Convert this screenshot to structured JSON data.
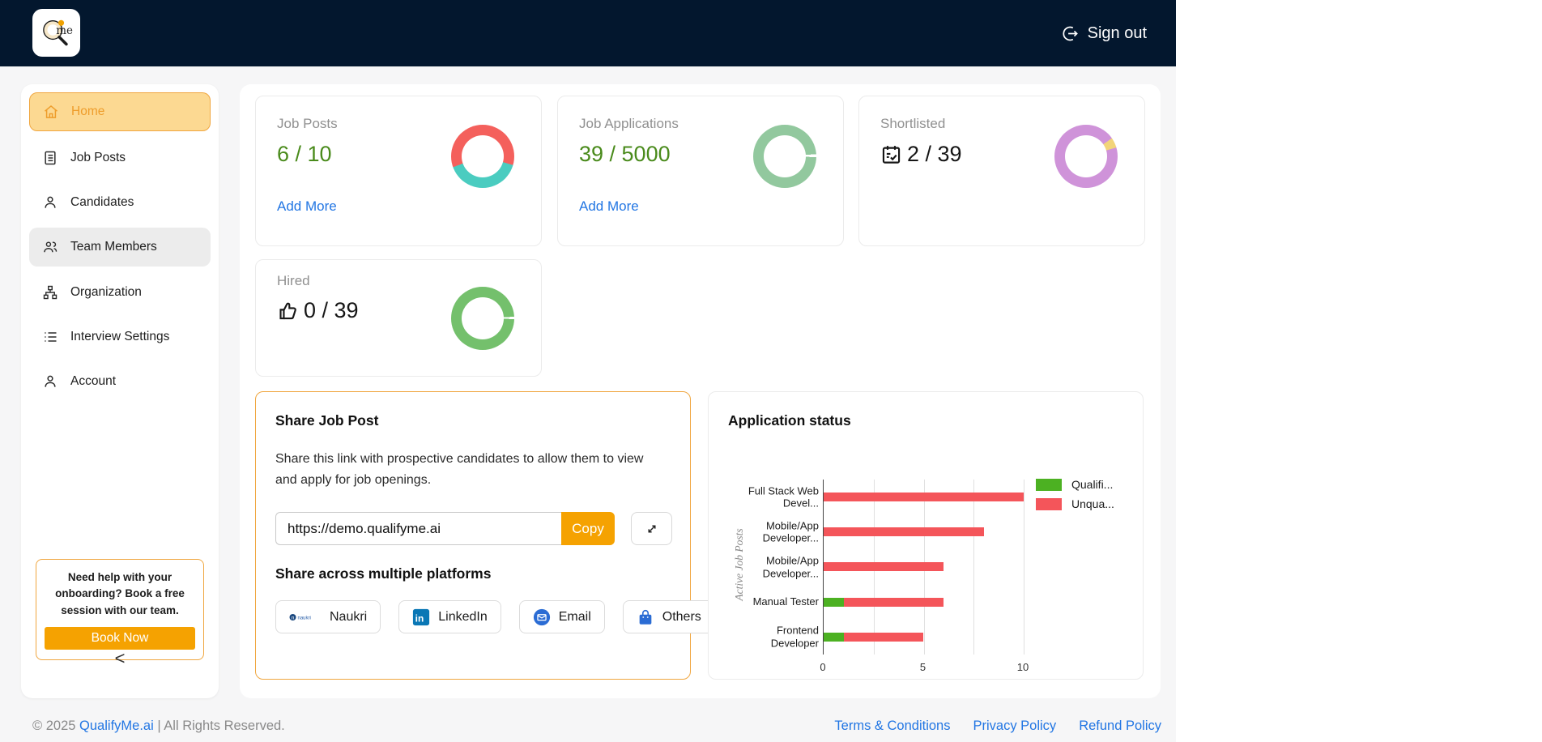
{
  "colors": {
    "navy": "#03172e",
    "accent": "#f5a201",
    "accent-border": "#f0a63f",
    "active-bg": "#fcd992",
    "accent-text": "#ee9d2b",
    "link": "#2276e3",
    "green": "#4a8b1c"
  },
  "navbar": {
    "logo_text": "me",
    "sign_out_label": "Sign out"
  },
  "sidebar": {
    "items": [
      {
        "label": "Home"
      },
      {
        "label": "Job Posts"
      },
      {
        "label": "Candidates"
      },
      {
        "label": "Team Members"
      },
      {
        "label": "Organization"
      },
      {
        "label": "Interview Settings"
      },
      {
        "label": "Account"
      }
    ],
    "help": {
      "text": "Need help with your onboarding? Book a free session with our team.",
      "button_label": "Book Now"
    },
    "collapse_glyph": "<"
  },
  "stats": [
    {
      "title": "Job Posts",
      "value": "6 / 10",
      "link": "Add More",
      "donut": {
        "from": 250,
        "segments": [
          [
            "#f4605c",
            60
          ],
          [
            "#4accc0",
            40
          ]
        ]
      }
    },
    {
      "title": "Job Applications",
      "value": "39 / 5000",
      "link": "Add More",
      "donut": {
        "from": 86,
        "segments": [
          [
            "#ffffff",
            1.5
          ],
          [
            "#92c89e",
            98.5
          ]
        ]
      }
    },
    {
      "title": "Shortlisted",
      "value": "2 / 39",
      "donut": {
        "from": 55,
        "segments": [
          [
            "#f2d478",
            5.2
          ],
          [
            "#cf93d9",
            94.8
          ]
        ]
      }
    },
    {
      "title": "Hired",
      "value": "0 / 39",
      "donut": {
        "from": 87,
        "segments": [
          [
            "#ffffff",
            1.2
          ],
          [
            "#74c06c",
            98.8
          ]
        ]
      }
    }
  ],
  "share": {
    "title": "Share Job Post",
    "description": "Share this link with prospective candidates to allow them to view and apply for job openings.",
    "link_value": "https://demo.qualifyme.ai",
    "copy_label": "Copy",
    "subtitle": "Share across multiple platforms",
    "platforms": [
      {
        "label": "Naukri"
      },
      {
        "label": "LinkedIn"
      },
      {
        "label": "Email"
      },
      {
        "label": "Others"
      }
    ]
  },
  "chart_data": {
    "type": "bar",
    "orientation": "horizontal",
    "stacked": true,
    "title": "Application status",
    "categories": [
      "Full Stack Web Devel...",
      "Mobile/App Developer...",
      "Mobile/App Developer...",
      "Manual Tester",
      "Frontend Developer"
    ],
    "category_lines": [
      [
        "Full Stack Web",
        "Devel..."
      ],
      [
        "Mobile/App",
        "Developer..."
      ],
      [
        "Mobile/App",
        "Developer..."
      ],
      [
        "Manual Tester"
      ],
      [
        "Frontend",
        "Developer"
      ]
    ],
    "series": [
      {
        "name": "Qualifi...",
        "color": "#4cb122",
        "values": [
          0,
          0,
          0,
          1,
          1
        ]
      },
      {
        "name": "Unqua...",
        "color": "#f4555a",
        "values": [
          10,
          8,
          6,
          5,
          4
        ]
      }
    ],
    "ylabel": "Active Job Posts",
    "xlabel": "",
    "xlim": [
      0,
      10
    ],
    "xticks": [
      0,
      5,
      10
    ],
    "gridlines": [
      2.5,
      5,
      7.5,
      10
    ],
    "legend_position": "top-right",
    "grid": true
  },
  "footer": {
    "copyright_prefix": "© 2025 ",
    "brand": "QualifyMe.ai",
    "copyright_suffix": " | All Rights Reserved.",
    "links": [
      {
        "label": "Terms & Conditions"
      },
      {
        "label": "Privacy Policy"
      },
      {
        "label": "Refund Policy"
      }
    ]
  }
}
